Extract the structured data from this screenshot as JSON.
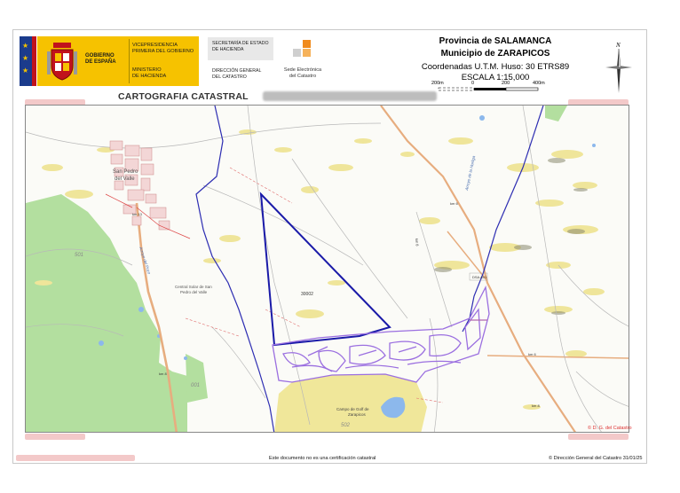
{
  "header": {
    "government": {
      "line1": "GOBIERNO",
      "line2": "DE ESPAÑA"
    },
    "vicepresidencia": {
      "line1": "VICEPRESIDENCIA",
      "line2": "PRIMERA DEL GOBIERNO"
    },
    "ministerio": {
      "line1": "MINISTERIO",
      "line2": "DE HACIENDA"
    },
    "secretaria": {
      "line1": "SECRETARÍA DE ESTADO",
      "line2": "DE HACIENDA"
    },
    "direccion": {
      "line1": "DIRECCIÓN GENERAL",
      "line2": "DEL CATASTRO"
    },
    "sede": {
      "line1": "Sede Electrónica",
      "line2": "del Catastro"
    },
    "provincia": "Provincia de SALAMANCA",
    "municipio": "Municipio de ZARAPICOS",
    "coordenadas": "Coordenadas U.T.M. Huso: 30 ETRS89",
    "escala": "ESCALA 1:15,000",
    "scalebar_labels": [
      "200m",
      "0",
      "200",
      "400m"
    ],
    "north_label": "N",
    "section_title": "CARTOGRAFIA CATASTRAL"
  },
  "map": {
    "labels": {
      "town": "San Pedro",
      "town2": "del Valle",
      "parcel_id": "30002",
      "poligono_501": "501",
      "poligono_001": "001",
      "poligono_502": "502",
      "golf": "Campo de Golf de",
      "golf2": "Zarapicos",
      "central": "Central Solar de San",
      "central2": "Pedro del Valle",
      "arroyo_hurlga": "Arroyo de la Hurliga",
      "arroyo_left": "Arroyo del Pozo",
      "road_dsa": "DSA-601",
      "road_km": "km 13",
      "road_km2": "km 6",
      "road_km3": "km 8",
      "road_km4": "km 6",
      "road_km5": "km 8",
      "road_km6": "km 8"
    },
    "copyright": "© D. G. del Catastro"
  },
  "footer": {
    "note": "Este documento no es una certificación catastral",
    "copyright": "© Dirección General del Catastro 31/01/25"
  },
  "colors": {
    "gov_yellow": "#f6c200",
    "flag_blue": "#1b3b8c",
    "flag_red": "#c1121c",
    "boundary_blue": "#1a1aa8",
    "parcel_purple": "#8a5cd6",
    "green_area": "#a9dc9a",
    "yellow_area": "#eee48f",
    "road_orange": "#e0a070",
    "water_blue": "#8cb8ec"
  }
}
